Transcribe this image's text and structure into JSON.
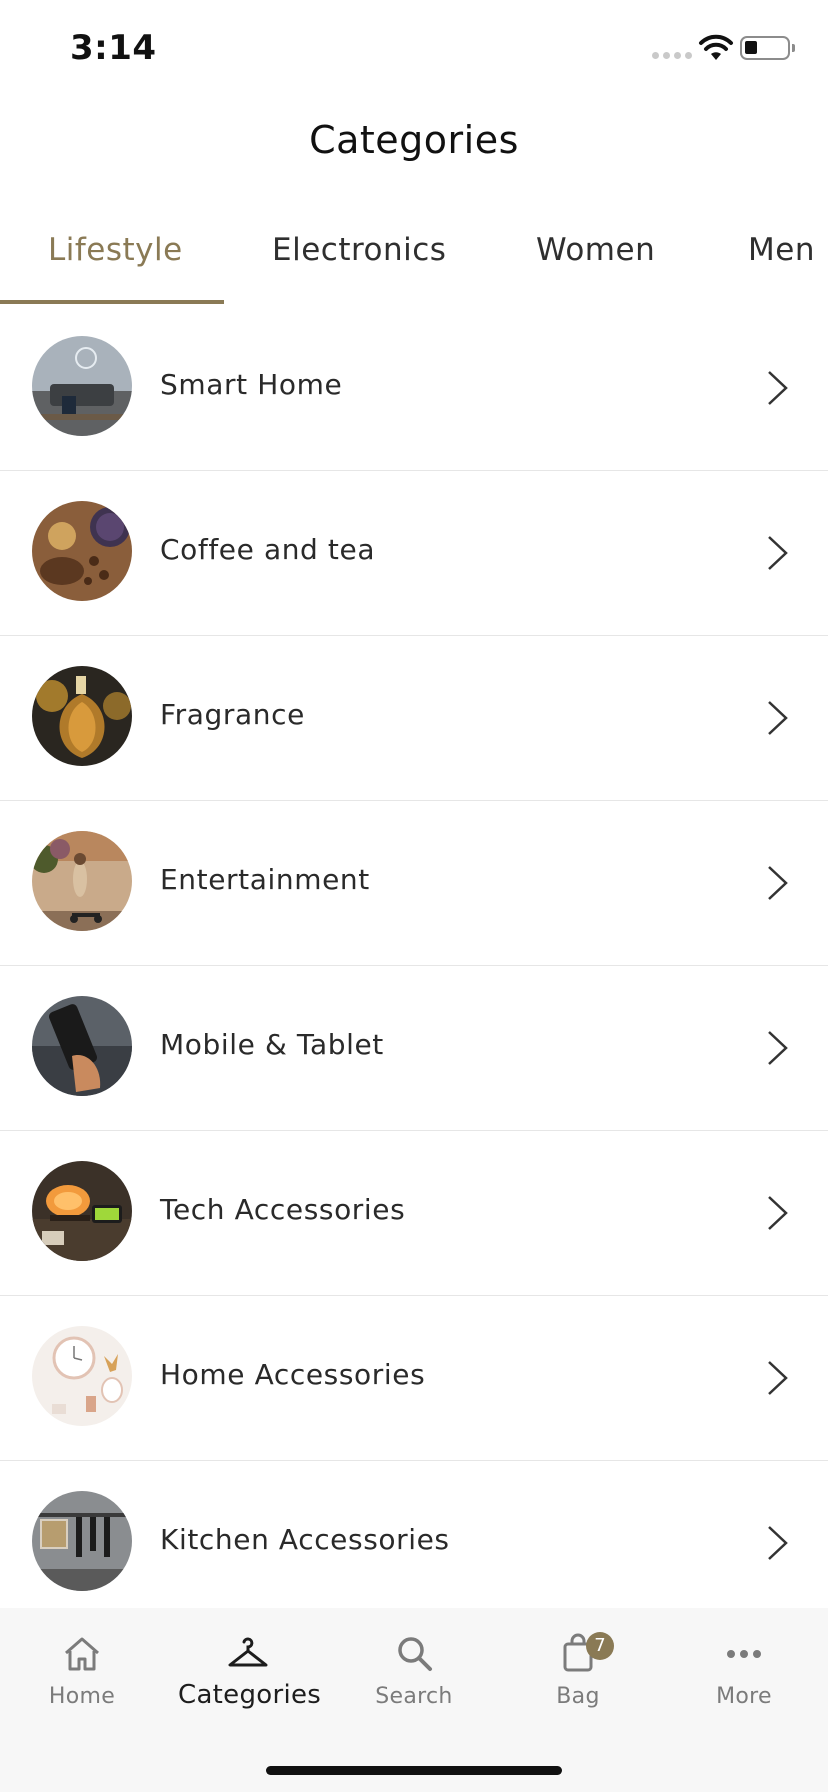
{
  "status_bar": {
    "time": "3:14"
  },
  "header": {
    "title": "Categories"
  },
  "tabs": [
    {
      "label": "Lifestyle",
      "active": true
    },
    {
      "label": "Electronics",
      "active": false
    },
    {
      "label": "Women",
      "active": false
    },
    {
      "label": "Men",
      "active": false
    }
  ],
  "categories": [
    {
      "label": "Smart Home",
      "icon": "smart-home-thumbnail"
    },
    {
      "label": "Coffee and tea",
      "icon": "coffee-tea-thumbnail"
    },
    {
      "label": "Fragrance",
      "icon": "fragrance-thumbnail"
    },
    {
      "label": "Entertainment",
      "icon": "entertainment-thumbnail"
    },
    {
      "label": "Mobile & Tablet",
      "icon": "mobile-tablet-thumbnail"
    },
    {
      "label": "Tech Accessories",
      "icon": "tech-accessories-thumbnail"
    },
    {
      "label": "Home Accessories",
      "icon": "home-accessories-thumbnail"
    },
    {
      "label": "Kitchen Accessories",
      "icon": "kitchen-accessories-thumbnail"
    }
  ],
  "tab_bar": {
    "items": [
      {
        "label": "Home",
        "icon": "home-icon",
        "active": false
      },
      {
        "label": "Categories",
        "icon": "hanger-icon",
        "active": true
      },
      {
        "label": "Search",
        "icon": "search-icon",
        "active": false
      },
      {
        "label": "Bag",
        "icon": "bag-icon",
        "active": false,
        "badge": "7"
      },
      {
        "label": "More",
        "icon": "more-icon",
        "active": false
      }
    ]
  },
  "colors": {
    "accent": "#8a7a55",
    "text": "#2a2a2a",
    "tabbar_bg": "#f7f7f7",
    "divider": "#e6e6e6"
  }
}
